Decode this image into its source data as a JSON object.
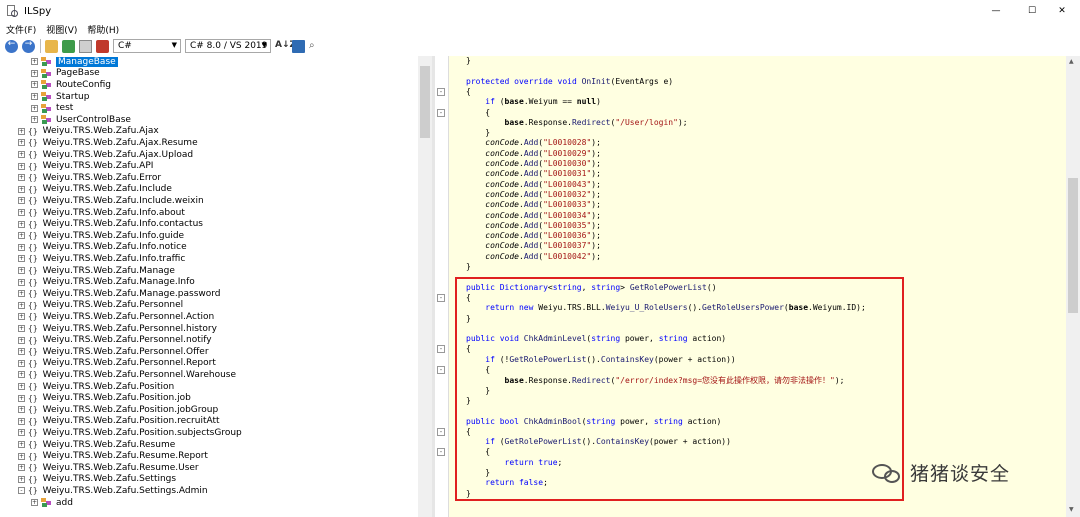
{
  "window": {
    "title": "ILSpy",
    "minimize": "—",
    "maximize": "☐",
    "close": "✕"
  },
  "menu": [
    "文件(F)",
    "视图(V)",
    "帮助(H)"
  ],
  "toolbar": {
    "language": "C#",
    "version": "C# 8.0 / VS 2019",
    "dropdown_arrow": "▼",
    "sort_label": "A↓Z",
    "search_glyph": "⌕"
  },
  "icons": {
    "back": "back-arrow-icon",
    "forward": "forward-arrow-icon",
    "open": "open-file-icon",
    "reload": "reload-icon",
    "tree": "show-tree-icon",
    "resources": "resources-icon",
    "sort": "sort-alpha-icon",
    "book": "book-icon",
    "search": "search-icon",
    "expand_glyph": "+",
    "collapse_glyph": "-",
    "namespace_glyph": "{}"
  },
  "tree": {
    "classes": [
      "ManageBase",
      "PageBase",
      "RouteConfig",
      "Startup",
      "test",
      "UserControlBase"
    ],
    "namespaces": [
      "Weiyu.TRS.Web.Zafu.Ajax",
      "Weiyu.TRS.Web.Zafu.Ajax.Resume",
      "Weiyu.TRS.Web.Zafu.Ajax.Upload",
      "Weiyu.TRS.Web.Zafu.API",
      "Weiyu.TRS.Web.Zafu.Error",
      "Weiyu.TRS.Web.Zafu.Include",
      "Weiyu.TRS.Web.Zafu.Include.weixin",
      "Weiyu.TRS.Web.Zafu.Info.about",
      "Weiyu.TRS.Web.Zafu.Info.contactus",
      "Weiyu.TRS.Web.Zafu.Info.guide",
      "Weiyu.TRS.Web.Zafu.Info.notice",
      "Weiyu.TRS.Web.Zafu.Info.traffic",
      "Weiyu.TRS.Web.Zafu.Manage",
      "Weiyu.TRS.Web.Zafu.Manage.Info",
      "Weiyu.TRS.Web.Zafu.Manage.password",
      "Weiyu.TRS.Web.Zafu.Personnel",
      "Weiyu.TRS.Web.Zafu.Personnel.Action",
      "Weiyu.TRS.Web.Zafu.Personnel.history",
      "Weiyu.TRS.Web.Zafu.Personnel.notify",
      "Weiyu.TRS.Web.Zafu.Personnel.Offer",
      "Weiyu.TRS.Web.Zafu.Personnel.Report",
      "Weiyu.TRS.Web.Zafu.Personnel.Warehouse",
      "Weiyu.TRS.Web.Zafu.Position",
      "Weiyu.TRS.Web.Zafu.Position.job",
      "Weiyu.TRS.Web.Zafu.Position.jobGroup",
      "Weiyu.TRS.Web.Zafu.Position.recruitAtt",
      "Weiyu.TRS.Web.Zafu.Position.subjectsGroup",
      "Weiyu.TRS.Web.Zafu.Resume",
      "Weiyu.TRS.Web.Zafu.Resume.Report",
      "Weiyu.TRS.Web.Zafu.Resume.User",
      "Weiyu.TRS.Web.Zafu.Settings",
      "Weiyu.TRS.Web.Zafu.Settings.Admin"
    ],
    "last_child": "add",
    "selected": "ManageBase"
  },
  "code": {
    "lines": [
      [
        {
          "t": "}",
          "c": ""
        }
      ],
      [
        {
          "t": "",
          "c": ""
        }
      ],
      [
        {
          "t": "protected override void ",
          "c": "kw"
        },
        {
          "t": "OnInit",
          "c": "fn"
        },
        {
          "t": "(EventArgs e)",
          "c": ""
        }
      ],
      [
        {
          "t": "{",
          "c": ""
        }
      ],
      [
        {
          "t": "    ",
          "c": ""
        },
        {
          "t": "if",
          "c": "kw"
        },
        {
          "t": " (",
          "c": ""
        },
        {
          "t": "base",
          "c": "bold"
        },
        {
          "t": ".Weiyum == ",
          "c": ""
        },
        {
          "t": "null",
          "c": "bold"
        },
        {
          "t": ")",
          "c": ""
        }
      ],
      [
        {
          "t": "    {",
          "c": ""
        }
      ],
      [
        {
          "t": "        ",
          "c": ""
        },
        {
          "t": "base",
          "c": "bold"
        },
        {
          "t": ".Response.",
          "c": ""
        },
        {
          "t": "Redirect",
          "c": "fn"
        },
        {
          "t": "(",
          "c": ""
        },
        {
          "t": "\"/User/login\"",
          "c": "str"
        },
        {
          "t": ");",
          "c": ""
        }
      ],
      [
        {
          "t": "    }",
          "c": ""
        }
      ],
      [
        {
          "t": "    ",
          "c": ""
        },
        {
          "t": "conCode",
          "c": "var"
        },
        {
          "t": ".",
          "c": ""
        },
        {
          "t": "Add",
          "c": "fn"
        },
        {
          "t": "(",
          "c": ""
        },
        {
          "t": "\"L0010028\"",
          "c": "str"
        },
        {
          "t": ");",
          "c": ""
        }
      ],
      [
        {
          "t": "    ",
          "c": ""
        },
        {
          "t": "conCode",
          "c": "var"
        },
        {
          "t": ".",
          "c": ""
        },
        {
          "t": "Add",
          "c": "fn"
        },
        {
          "t": "(",
          "c": ""
        },
        {
          "t": "\"L0010029\"",
          "c": "str"
        },
        {
          "t": ");",
          "c": ""
        }
      ],
      [
        {
          "t": "    ",
          "c": ""
        },
        {
          "t": "conCode",
          "c": "var"
        },
        {
          "t": ".",
          "c": ""
        },
        {
          "t": "Add",
          "c": "fn"
        },
        {
          "t": "(",
          "c": ""
        },
        {
          "t": "\"L0010030\"",
          "c": "str"
        },
        {
          "t": ");",
          "c": ""
        }
      ],
      [
        {
          "t": "    ",
          "c": ""
        },
        {
          "t": "conCode",
          "c": "var"
        },
        {
          "t": ".",
          "c": ""
        },
        {
          "t": "Add",
          "c": "fn"
        },
        {
          "t": "(",
          "c": ""
        },
        {
          "t": "\"L0010031\"",
          "c": "str"
        },
        {
          "t": ");",
          "c": ""
        }
      ],
      [
        {
          "t": "    ",
          "c": ""
        },
        {
          "t": "conCode",
          "c": "var"
        },
        {
          "t": ".",
          "c": ""
        },
        {
          "t": "Add",
          "c": "fn"
        },
        {
          "t": "(",
          "c": ""
        },
        {
          "t": "\"L0010043\"",
          "c": "str"
        },
        {
          "t": ");",
          "c": ""
        }
      ],
      [
        {
          "t": "    ",
          "c": ""
        },
        {
          "t": "conCode",
          "c": "var"
        },
        {
          "t": ".",
          "c": ""
        },
        {
          "t": "Add",
          "c": "fn"
        },
        {
          "t": "(",
          "c": ""
        },
        {
          "t": "\"L0010032\"",
          "c": "str"
        },
        {
          "t": ");",
          "c": ""
        }
      ],
      [
        {
          "t": "    ",
          "c": ""
        },
        {
          "t": "conCode",
          "c": "var"
        },
        {
          "t": ".",
          "c": ""
        },
        {
          "t": "Add",
          "c": "fn"
        },
        {
          "t": "(",
          "c": ""
        },
        {
          "t": "\"L0010033\"",
          "c": "str"
        },
        {
          "t": ");",
          "c": ""
        }
      ],
      [
        {
          "t": "    ",
          "c": ""
        },
        {
          "t": "conCode",
          "c": "var"
        },
        {
          "t": ".",
          "c": ""
        },
        {
          "t": "Add",
          "c": "fn"
        },
        {
          "t": "(",
          "c": ""
        },
        {
          "t": "\"L0010034\"",
          "c": "str"
        },
        {
          "t": ");",
          "c": ""
        }
      ],
      [
        {
          "t": "    ",
          "c": ""
        },
        {
          "t": "conCode",
          "c": "var"
        },
        {
          "t": ".",
          "c": ""
        },
        {
          "t": "Add",
          "c": "fn"
        },
        {
          "t": "(",
          "c": ""
        },
        {
          "t": "\"L0010035\"",
          "c": "str"
        },
        {
          "t": ");",
          "c": ""
        }
      ],
      [
        {
          "t": "    ",
          "c": ""
        },
        {
          "t": "conCode",
          "c": "var"
        },
        {
          "t": ".",
          "c": ""
        },
        {
          "t": "Add",
          "c": "fn"
        },
        {
          "t": "(",
          "c": ""
        },
        {
          "t": "\"L0010036\"",
          "c": "str"
        },
        {
          "t": ");",
          "c": ""
        }
      ],
      [
        {
          "t": "    ",
          "c": ""
        },
        {
          "t": "conCode",
          "c": "var"
        },
        {
          "t": ".",
          "c": ""
        },
        {
          "t": "Add",
          "c": "fn"
        },
        {
          "t": "(",
          "c": ""
        },
        {
          "t": "\"L0010037\"",
          "c": "str"
        },
        {
          "t": ");",
          "c": ""
        }
      ],
      [
        {
          "t": "    ",
          "c": ""
        },
        {
          "t": "conCode",
          "c": "var"
        },
        {
          "t": ".",
          "c": ""
        },
        {
          "t": "Add",
          "c": "fn"
        },
        {
          "t": "(",
          "c": ""
        },
        {
          "t": "\"L0010042\"",
          "c": "str"
        },
        {
          "t": ");",
          "c": ""
        }
      ],
      [
        {
          "t": "}",
          "c": ""
        }
      ],
      [
        {
          "t": "",
          "c": ""
        }
      ],
      [
        {
          "t": "public ",
          "c": "kw"
        },
        {
          "t": "Dictionary",
          "c": "kw"
        },
        {
          "t": "<",
          "c": ""
        },
        {
          "t": "string",
          "c": "kw"
        },
        {
          "t": ", ",
          "c": ""
        },
        {
          "t": "string",
          "c": "kw"
        },
        {
          "t": "> ",
          "c": ""
        },
        {
          "t": "GetRolePowerList",
          "c": "fn"
        },
        {
          "t": "()",
          "c": ""
        }
      ],
      [
        {
          "t": "{",
          "c": ""
        }
      ],
      [
        {
          "t": "    ",
          "c": ""
        },
        {
          "t": "return new ",
          "c": "kw"
        },
        {
          "t": "Weiyu.TRS.BLL.",
          "c": ""
        },
        {
          "t": "Weiyu_U_RoleUsers",
          "c": "fn"
        },
        {
          "t": "().",
          "c": ""
        },
        {
          "t": "GetRoleUsersPower",
          "c": "fn"
        },
        {
          "t": "(",
          "c": ""
        },
        {
          "t": "base",
          "c": "bold"
        },
        {
          "t": ".Weiyum.ID);",
          "c": ""
        }
      ],
      [
        {
          "t": "}",
          "c": ""
        }
      ],
      [
        {
          "t": "",
          "c": ""
        }
      ],
      [
        {
          "t": "public void ",
          "c": "kw"
        },
        {
          "t": "ChkAdminLevel",
          "c": "fn"
        },
        {
          "t": "(",
          "c": ""
        },
        {
          "t": "string",
          "c": "kw"
        },
        {
          "t": " power, ",
          "c": ""
        },
        {
          "t": "string",
          "c": "kw"
        },
        {
          "t": " action)",
          "c": ""
        }
      ],
      [
        {
          "t": "{",
          "c": ""
        }
      ],
      [
        {
          "t": "    ",
          "c": ""
        },
        {
          "t": "if",
          "c": "kw"
        },
        {
          "t": " (!",
          "c": ""
        },
        {
          "t": "GetRolePowerList",
          "c": "fn"
        },
        {
          "t": "().",
          "c": ""
        },
        {
          "t": "ContainsKey",
          "c": "fn"
        },
        {
          "t": "(power + action))",
          "c": ""
        }
      ],
      [
        {
          "t": "    {",
          "c": ""
        }
      ],
      [
        {
          "t": "        ",
          "c": ""
        },
        {
          "t": "base",
          "c": "bold"
        },
        {
          "t": ".Response.",
          "c": ""
        },
        {
          "t": "Redirect",
          "c": "fn"
        },
        {
          "t": "(",
          "c": ""
        },
        {
          "t": "\"/error/index?msg=您没有此操作权限，请勿非法操作！\"",
          "c": "str"
        },
        {
          "t": ");",
          "c": ""
        }
      ],
      [
        {
          "t": "    }",
          "c": ""
        }
      ],
      [
        {
          "t": "}",
          "c": ""
        }
      ],
      [
        {
          "t": "",
          "c": ""
        }
      ],
      [
        {
          "t": "public bool ",
          "c": "kw"
        },
        {
          "t": "ChkAdminBool",
          "c": "fn"
        },
        {
          "t": "(",
          "c": ""
        },
        {
          "t": "string",
          "c": "kw"
        },
        {
          "t": " power, ",
          "c": ""
        },
        {
          "t": "string",
          "c": "kw"
        },
        {
          "t": " action)",
          "c": ""
        }
      ],
      [
        {
          "t": "{",
          "c": ""
        }
      ],
      [
        {
          "t": "    ",
          "c": ""
        },
        {
          "t": "if",
          "c": "kw"
        },
        {
          "t": " (",
          "c": ""
        },
        {
          "t": "GetRolePowerList",
          "c": "fn"
        },
        {
          "t": "().",
          "c": ""
        },
        {
          "t": "ContainsKey",
          "c": "fn"
        },
        {
          "t": "(power + action))",
          "c": ""
        }
      ],
      [
        {
          "t": "    {",
          "c": ""
        }
      ],
      [
        {
          "t": "        ",
          "c": ""
        },
        {
          "t": "return true",
          "c": "kw"
        },
        {
          "t": ";",
          "c": ""
        }
      ],
      [
        {
          "t": "    }",
          "c": ""
        }
      ],
      [
        {
          "t": "    ",
          "c": ""
        },
        {
          "t": "return false",
          "c": "kw"
        },
        {
          "t": ";",
          "c": ""
        }
      ],
      [
        {
          "t": "}",
          "c": ""
        }
      ]
    ]
  },
  "watermark": {
    "text": "猪猪谈安全"
  },
  "colors": {
    "selection": "#0078d7",
    "code_bg": "#ffffe1",
    "highlight_box": "#e02020",
    "keyword": "#0000ff",
    "string": "#a31515"
  }
}
